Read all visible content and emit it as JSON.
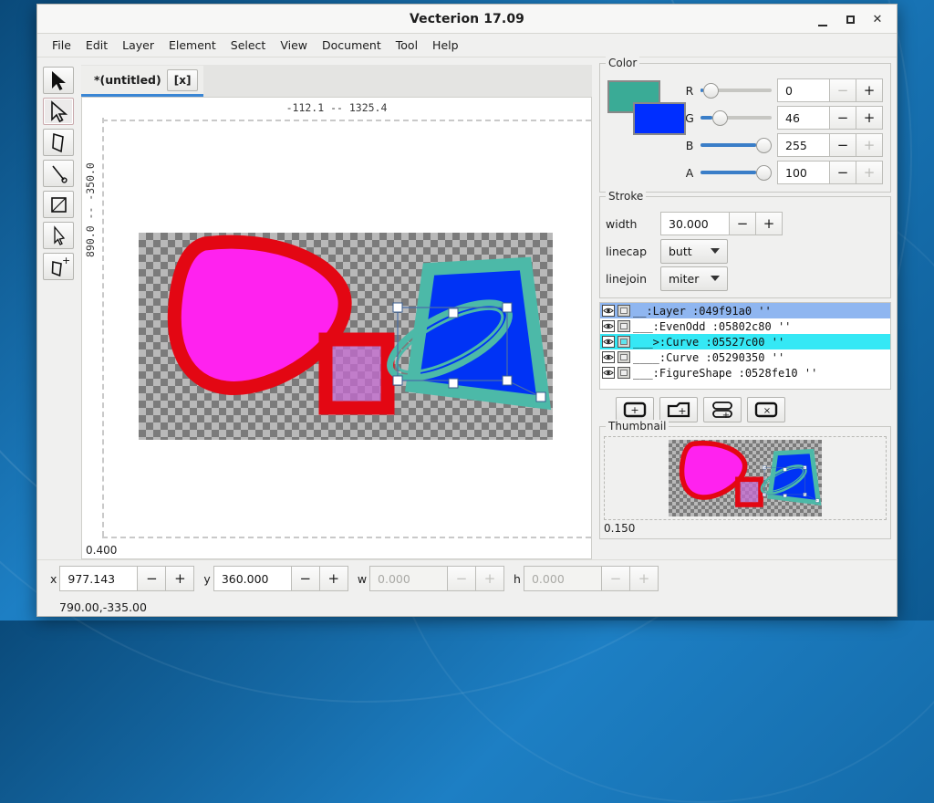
{
  "window": {
    "title": "Vecterion 17.09",
    "controls": [
      {
        "name": "minimize",
        "glyph": "_"
      },
      {
        "name": "maximize",
        "glyph": "□"
      },
      {
        "name": "close",
        "glyph": "✕"
      }
    ]
  },
  "menu": [
    "File",
    "Edit",
    "Layer",
    "Element",
    "Select",
    "View",
    "Document",
    "Tool",
    "Help"
  ],
  "tools": [
    {
      "name": "select-tool",
      "selected": false
    },
    {
      "name": "node-edit-tool",
      "selected": true
    },
    {
      "name": "shape-edit-tool",
      "selected": false
    },
    {
      "name": "line-tool",
      "selected": false
    },
    {
      "name": "rectangle-tool",
      "selected": false
    },
    {
      "name": "pen-tool",
      "selected": false
    },
    {
      "name": "add-shape-tool",
      "selected": false
    }
  ],
  "tab": {
    "label": "*(untitled)",
    "close": "[x]"
  },
  "canvas": {
    "hruler": "-112.1 -- 1325.4",
    "vruler": "890.0 -- -350.0",
    "zoom": "0.400"
  },
  "color": {
    "title": "Color",
    "stroke_swatch": "#3aab96",
    "fill_swatch": "#002eff",
    "channels": [
      {
        "label": "R",
        "value": "0",
        "pct": 0,
        "minus_disabled": true,
        "plus_disabled": false
      },
      {
        "label": "G",
        "value": "46",
        "pct": 18,
        "minus_disabled": false,
        "plus_disabled": false
      },
      {
        "label": "B",
        "value": "255",
        "pct": 100,
        "minus_disabled": false,
        "plus_disabled": true
      },
      {
        "label": "A",
        "value": "100",
        "pct": 100,
        "minus_disabled": false,
        "plus_disabled": true
      }
    ]
  },
  "stroke": {
    "title": "Stroke",
    "width_label": "width",
    "width_value": "30.000",
    "linecap_label": "linecap",
    "linecap_value": "butt",
    "linejoin_label": "linejoin",
    "linejoin_value": "miter"
  },
  "tree": {
    "rows": [
      {
        "indent": "__",
        "name": ":Layer",
        "addr": ":049f91a0",
        "quote": "''",
        "state": "selected-primary",
        "vis": false
      },
      {
        "indent": "___",
        "name": ":EvenOdd",
        "addr": ":05802c80",
        "quote": "''",
        "state": "none",
        "vis": false
      },
      {
        "indent": "___>",
        "name": ":Curve",
        "addr": ":05527c00",
        "quote": "''",
        "state": "selected-active",
        "vis": true
      },
      {
        "indent": "____",
        "name": ":Curve",
        "addr": ":05290350",
        "quote": "''",
        "state": "none",
        "vis": false
      },
      {
        "indent": "___",
        "name": ":FigureShape",
        "addr": ":0528fe10",
        "quote": "''",
        "state": "none",
        "vis": false
      }
    ],
    "buttons": [
      {
        "name": "new-element-button"
      },
      {
        "name": "new-layer-button"
      },
      {
        "name": "new-sublayer-button"
      },
      {
        "name": "delete-element-button"
      }
    ]
  },
  "thumbnail": {
    "title": "Thumbnail",
    "scale": "0.150"
  },
  "bottom": {
    "fields": [
      {
        "label": "x",
        "value": "977.143",
        "disabled": false
      },
      {
        "label": "y",
        "value": "360.000",
        "disabled": false
      },
      {
        "label": "w",
        "value": "0.000",
        "disabled": true
      },
      {
        "label": "h",
        "value": "0.000",
        "disabled": true
      }
    ],
    "status": "790.00,-335.00"
  },
  "artwork": {
    "blob_fill": "#ff22ef",
    "blob_stroke": "#e30713",
    "square_fill": "#c46ad0",
    "square_stroke": "#e30713",
    "poly_fill": "#0033f5",
    "poly_stroke": "#4cb9a8",
    "handle_color": "#ffffff"
  }
}
